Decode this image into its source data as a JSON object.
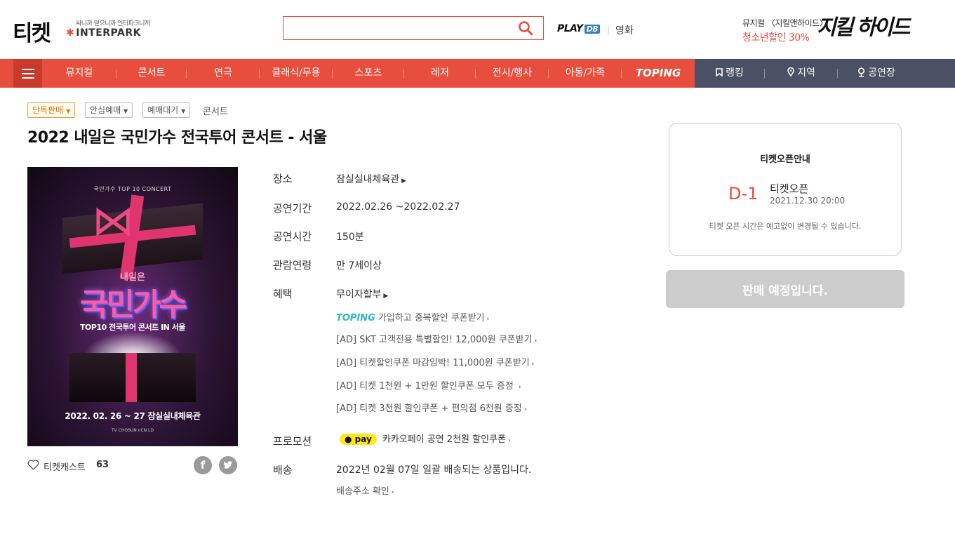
{
  "header": {
    "logo": "티켓",
    "interpark_slogan": "싸니까 믿으니까 인터파크니까",
    "interpark_brand": "INTERPARK",
    "search_placeholder": "",
    "playdb": "PLAY",
    "playdb_badge": "DB",
    "movie": "영화",
    "ad_line1": "뮤지컬 〈지킬앤하이드〉",
    "ad_line2": "청소년할인 30%",
    "ad_title": "지킬 하이드"
  },
  "nav": {
    "items": [
      "뮤지컬",
      "콘서트",
      "연극",
      "클래식/무용",
      "스포츠",
      "레저",
      "전시/행사",
      "아동/가족",
      "TOPING"
    ],
    "right_items": [
      "랭킹",
      "지역",
      "공연장"
    ]
  },
  "breadcrumb": {
    "chips": [
      "단독판매",
      "안심예매",
      "예매대기"
    ],
    "current": "콘서트"
  },
  "title": "2022 내일은 국민가수 전국투어 콘서트 - 서울",
  "poster": {
    "top_text": "국민가수 TOP 10 CONCERT",
    "sub": "내일은",
    "main": "국민가수",
    "tour": "TOP10 전국투어 콘서트 IN 서울",
    "date": "2022. 02. 26 ~ 27 잠실실내체육관",
    "logos": "TV CHOSUN   nCN   LD"
  },
  "ticketcast": {
    "label": "티켓캐스트",
    "count": "63"
  },
  "info": {
    "venue_label": "장소",
    "venue": "잠실실내체육관",
    "period_label": "공연기간",
    "period": "2022.02.26 ~2022.02.27",
    "duration_label": "공연시간",
    "duration": "150분",
    "age_label": "관람연령",
    "age": "만 7세이상",
    "benefit_label": "혜택",
    "benefit": "무이자할부",
    "benefit_items": [
      {
        "prefix": "TOPING",
        "text": "가입하고 중복할인 쿠폰받기"
      },
      {
        "prefix": "",
        "text": "[AD] SKT 고객전용 특별할인! 12,000원 쿠폰받기"
      },
      {
        "prefix": "",
        "text": "[AD] 티켓할인쿠폰 마감임박! 11,000원 쿠폰받기"
      },
      {
        "prefix": "",
        "text": "[AD] 티켓 1천원 + 1만원 할인쿠폰 모두 증정 "
      },
      {
        "prefix": "",
        "text": "[AD] 티켓 3천원 할인쿠폰 + 편의점 6천원 증정"
      }
    ],
    "promo_label": "프로모션",
    "promo_badge": "pay",
    "promo": "카카오페이 공연 2천원 할인쿠폰",
    "delivery_label": "배송",
    "delivery": "2022년 02월 07일 일괄 배송되는 상품입니다.",
    "delivery_link": "배송주소 확인"
  },
  "panel": {
    "title": "티켓오픈안내",
    "dday": "D-1",
    "open_label": "티켓오픈",
    "open_date": "2021.12.30 20:00",
    "notice": "티켓 오픈 시간은 예고없이 변경될 수 있습니다."
  },
  "sale_button": "판매 예정입니다.",
  "colors": {
    "accent": "#e84e3d",
    "nav_dark": "#4a5165",
    "disabled": "#cccccc"
  }
}
